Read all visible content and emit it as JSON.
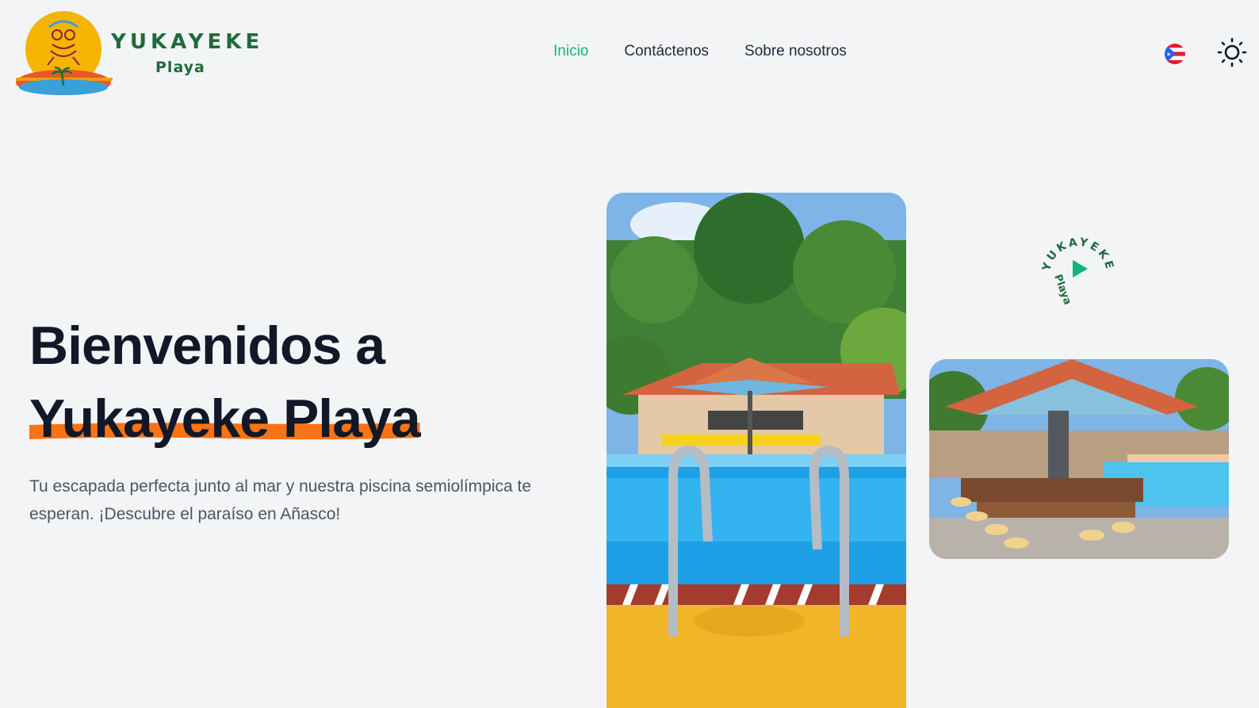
{
  "header": {
    "logo": {
      "wordmark": "YUKAYEKE",
      "subtitle": "Playa",
      "icon": "coqui-sun-logo-icon"
    },
    "nav": [
      {
        "label": "Inicio",
        "active": true
      },
      {
        "label": "Contáctenos",
        "active": false
      },
      {
        "label": "Sobre nosotros",
        "active": false
      }
    ],
    "language_icon": "puerto-rico-flag-icon",
    "theme_icon": "sun-icon"
  },
  "hero": {
    "title_line1": "Bienvenidos a",
    "title_line2": "Yukayeke Playa",
    "subtitle": "Tu escapada perfecta junto al mar y nuestra piscina semiolímpica te esperan. ¡Descubre el paraíso en Añasco!"
  },
  "media": {
    "badge_text_top": "YUKAYEKE",
    "badge_text_bottom": "Playa",
    "badge_icon": "play-icon"
  },
  "colors": {
    "accent_green": "#10b37a",
    "brush_orange": "#f97316",
    "text_dark": "#111827",
    "text_muted": "#4b5563",
    "background": "#f3f4f6"
  }
}
